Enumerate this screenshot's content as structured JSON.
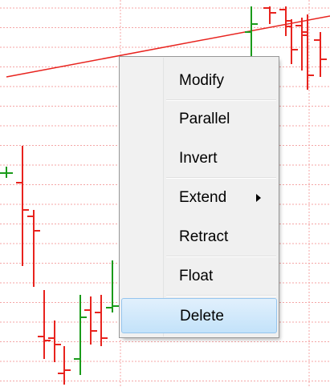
{
  "chart": {
    "grid_color": "#f4a6a6",
    "up_bar_color": "#1a9b1a",
    "down_bar_color": "#e8231e",
    "trendline_color": "#e8231e"
  },
  "context_menu": {
    "items": [
      {
        "label": "Modify"
      },
      {
        "label": "Parallel"
      },
      {
        "label": "Invert"
      },
      {
        "label": "Extend",
        "has_submenu": true
      },
      {
        "label": "Retract"
      },
      {
        "label": "Float"
      },
      {
        "label": "Delete",
        "highlighted": true
      }
    ]
  }
}
